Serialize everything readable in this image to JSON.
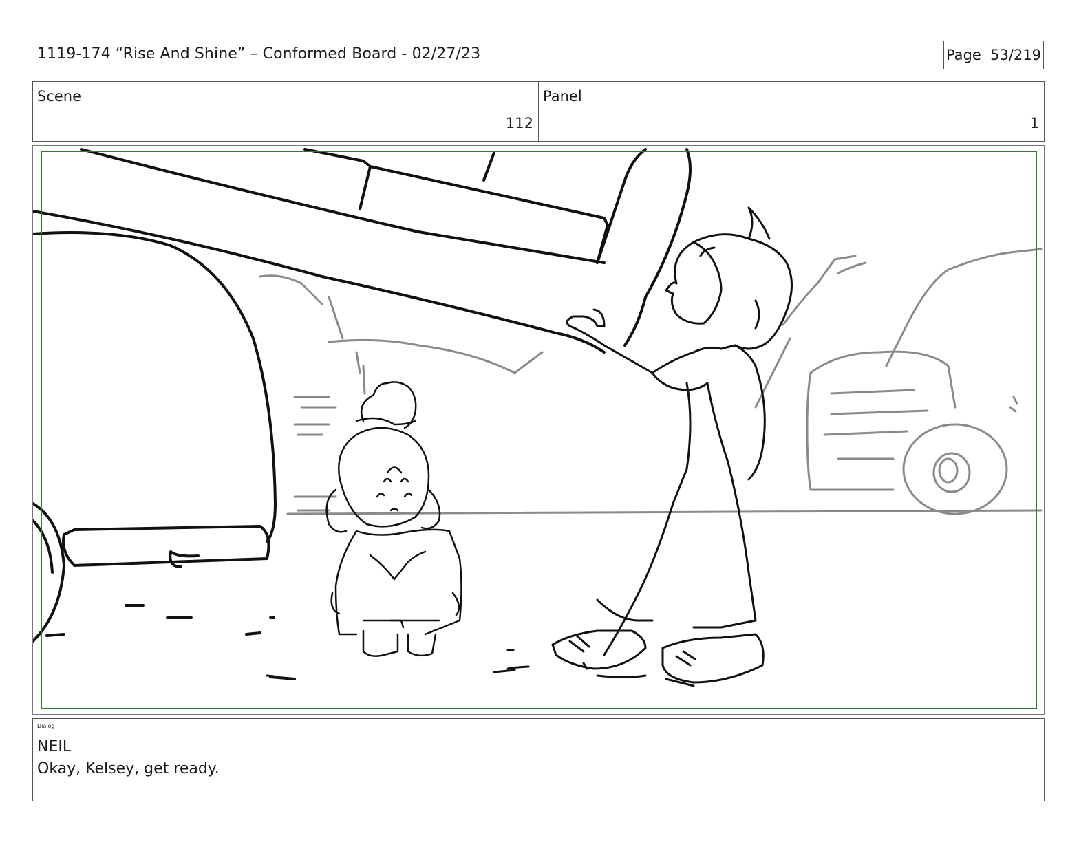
{
  "header": {
    "title": "1119-174 “Rise And Shine” – Conformed Board - 02/27/23",
    "page": "Page  53/219"
  },
  "scene": {
    "label": "Scene",
    "value": "112"
  },
  "panel": {
    "label": "Panel",
    "value": "1"
  },
  "dialog": {
    "label": "Dialog",
    "speaker": "NEIL",
    "line": "Okay, Kelsey, get ready."
  },
  "colors": {
    "safe_frame": "#2f7d2f",
    "sketch_line": "#111111",
    "background_line": "#8a8a8a"
  }
}
